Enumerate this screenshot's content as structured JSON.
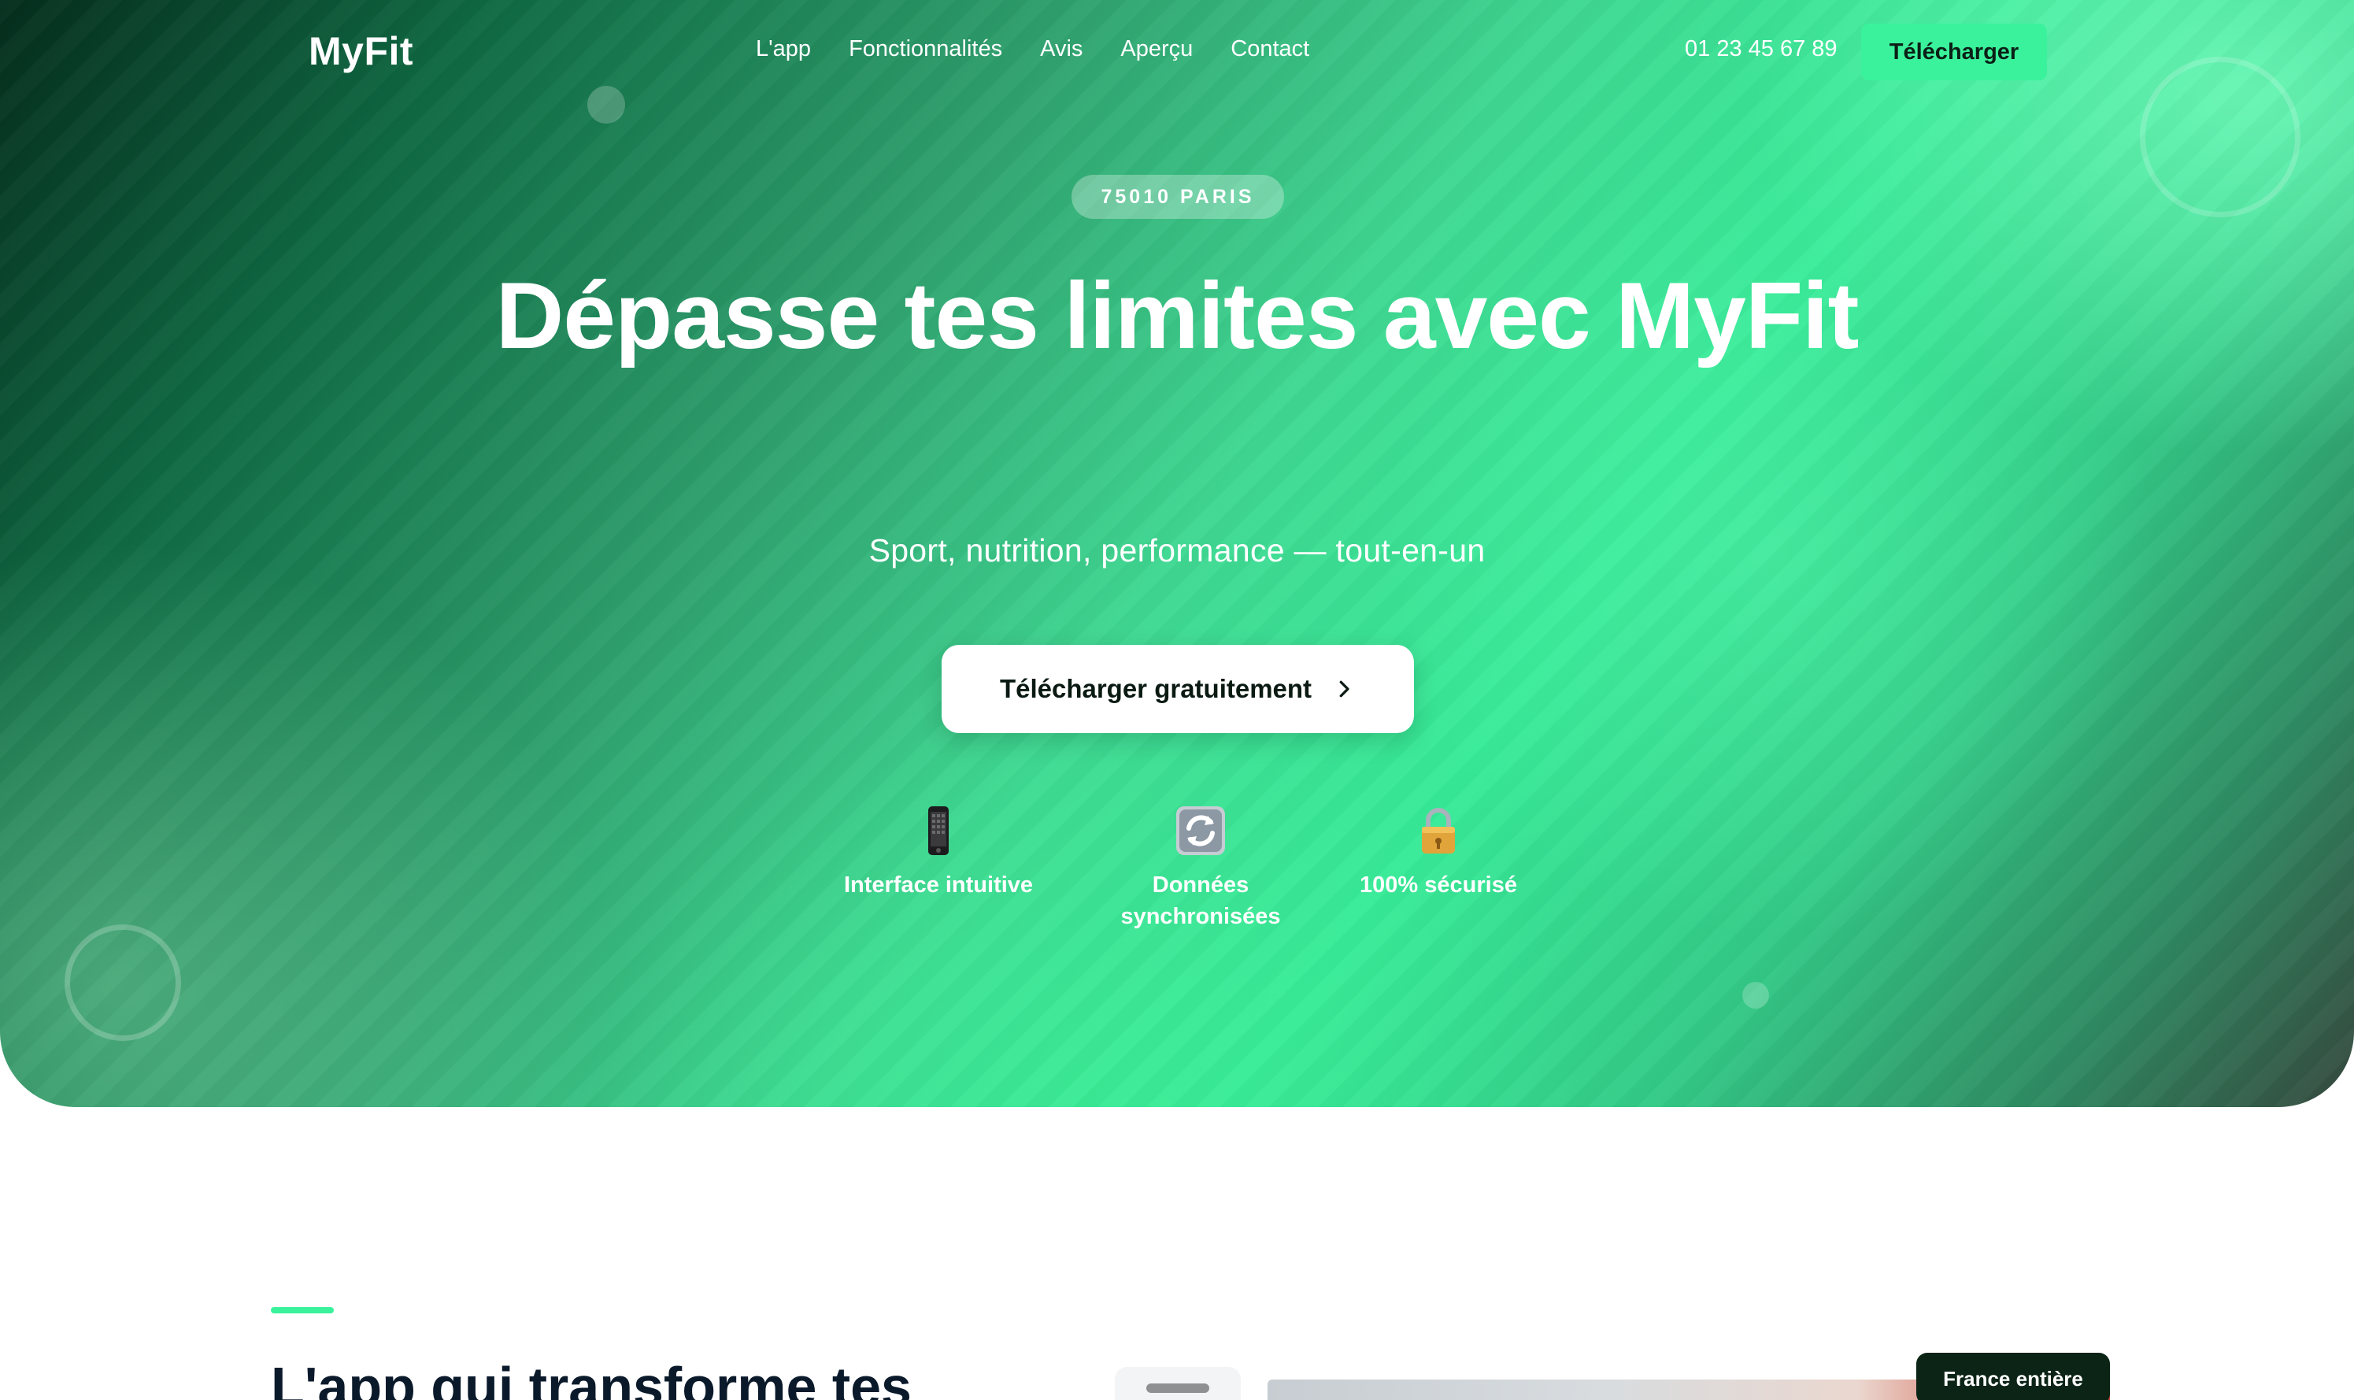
{
  "brand": {
    "name": "MyFit",
    "accent": "#3af29b"
  },
  "nav": {
    "links": [
      "L'app",
      "Fonctionnalités",
      "Avis",
      "Aperçu",
      "Contact"
    ],
    "phone": "01 23 45 67 89",
    "cta_label": "Télécharger"
  },
  "hero": {
    "badge": "75010 PARIS",
    "title": "Dépasse tes limites avec MyFit",
    "subtitle": "Sport, nutrition, performance — tout-en-un",
    "cta_label": "Télécharger gratuitement",
    "features": [
      {
        "icon": "phone-icon",
        "label": "Interface intuitive"
      },
      {
        "icon": "sync-icon",
        "label": "Données synchronisées"
      },
      {
        "icon": "lock-icon",
        "label": "100% sécurisé"
      }
    ]
  },
  "section": {
    "title": "L'app qui transforme tes",
    "badge": "France entière"
  }
}
